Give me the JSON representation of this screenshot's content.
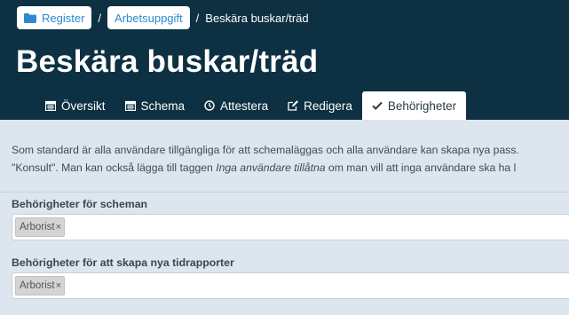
{
  "breadcrumbs": {
    "register": "Register",
    "task": "Arbetsuppgift",
    "current": "Beskära buskar/träd",
    "separator": "/"
  },
  "title": "Beskära buskar/träd",
  "tabs": [
    {
      "label": "Översikt",
      "icon": "calendar-icon"
    },
    {
      "label": "Schema",
      "icon": "calendar-icon"
    },
    {
      "label": "Attestera",
      "icon": "clock-icon"
    },
    {
      "label": "Redigera",
      "icon": "edit-icon"
    },
    {
      "label": "Behörigheter",
      "icon": "check-icon",
      "active": true
    }
  ],
  "intro": {
    "line1": "Som standard är alla användare tillgängliga för att schemaläggas och alla användare kan skapa nya pass.",
    "line2_before": "\"Konsult\". Man kan också lägga till taggen ",
    "line2_em": "Inga användare tillåtna",
    "line2_after": " om man vill att inga användare ska ha l"
  },
  "fields": [
    {
      "label": "Behörigheter för scheman",
      "chips": [
        {
          "text": "Arborist",
          "remove": "×"
        }
      ]
    },
    {
      "label": "Behörigheter för att skapa nya tidrapporter",
      "chips": [
        {
          "text": "Arborist",
          "remove": "×"
        }
      ]
    }
  ],
  "colors": {
    "header_bg": "#0d3142",
    "link": "#2a8ccf",
    "page_bg": "#dde5ee"
  }
}
